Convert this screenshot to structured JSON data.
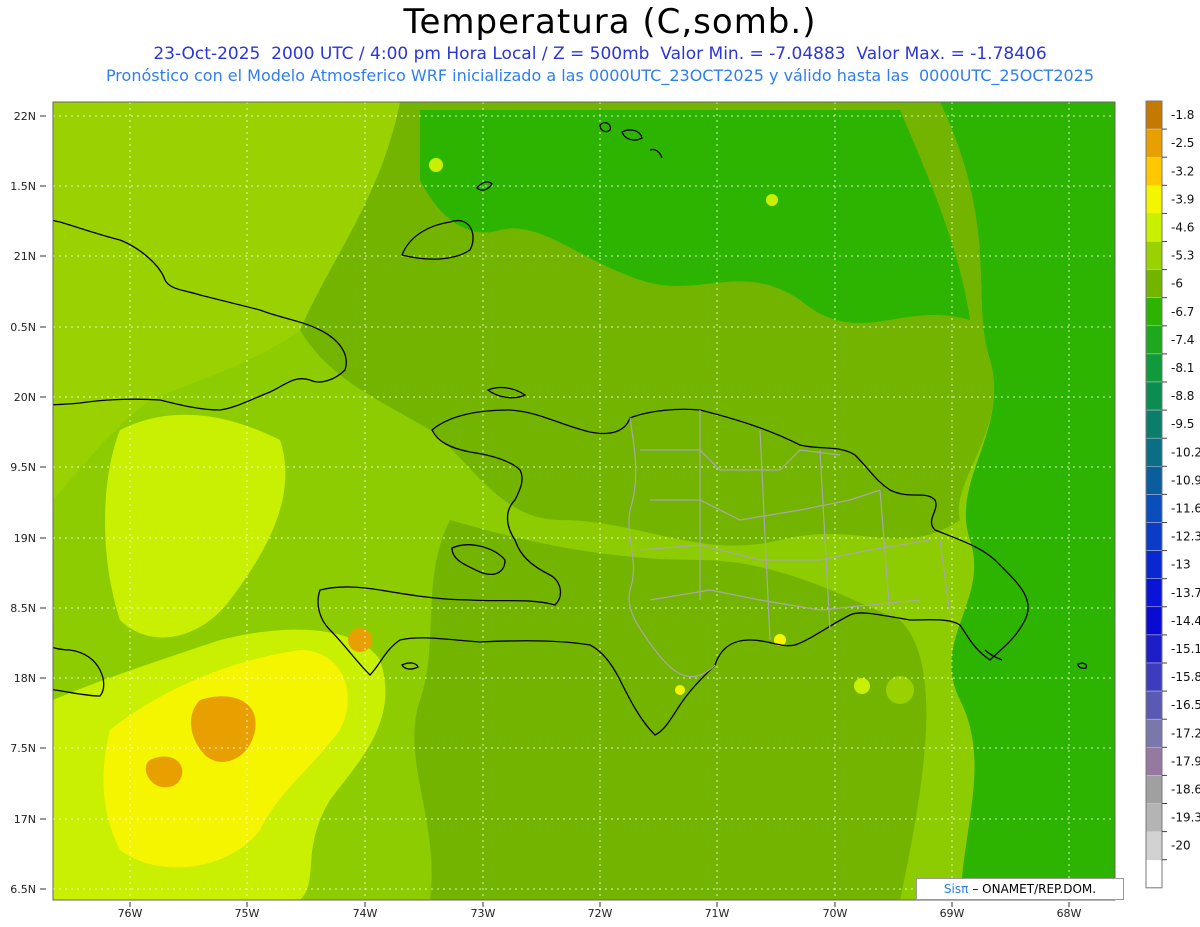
{
  "title": "Temperatura (C,somb.)",
  "subtitle_line1": "23-Oct-2025  2000 UTC / 4:00 pm Hora Local / Z = 500mb  Valor Min. = -7.04883  Valor Max. = -1.78406",
  "subtitle_line2": "Pronóstico con el Modelo Atmosferico WRF inicializado a las 0000UTC_23OCT2025 y válido hasta las  0000UTC_25OCT2025",
  "lat_labels": [
    "22N",
    "1.5N",
    "21N",
    "0.5N",
    "20N",
    "9.5N",
    "19N",
    "8.5N",
    "18N",
    "7.5N",
    "17N",
    "6.5N"
  ],
  "lon_labels": [
    "76W",
    "75W",
    "74W",
    "73W",
    "72W",
    "71W",
    "70W",
    "69W",
    "68W"
  ],
  "colorbar": {
    "labels": [
      "-1.8",
      "-2.5",
      "-3.2",
      "-3.9",
      "-4.6",
      "-5.3",
      "-6",
      "-6.7",
      "-7.4",
      "-8.1",
      "-8.8",
      "-9.5",
      "-10.2",
      "-10.9",
      "-11.6",
      "-12.3",
      "-13",
      "-13.7",
      "-14.4",
      "-15.1",
      "-15.8",
      "-16.5",
      "-17.2",
      "-17.9",
      "-18.6",
      "-19.3",
      "-20"
    ],
    "colors": [
      "#c47a00",
      "#e8a000",
      "#ffc800",
      "#f5f500",
      "#c8f000",
      "#99d200",
      "#73b400",
      "#2cb400",
      "#1ea81e",
      "#119a3a",
      "#0c8c50",
      "#0a7e6a",
      "#0a6e84",
      "#0a5e9e",
      "#0a4ebe",
      "#0a3cc8",
      "#0a28d2",
      "#0a14d6",
      "#0a0ad2",
      "#1e1ec8",
      "#3c3cbe",
      "#5a5ab4",
      "#7878aa",
      "#9678a0",
      "#a0a0a0",
      "#b4b4b4",
      "#d2d2d2",
      "#ffffff"
    ]
  },
  "credit": {
    "logo": "Sisπ",
    "text": "– ONAMET/REP.DOM."
  }
}
